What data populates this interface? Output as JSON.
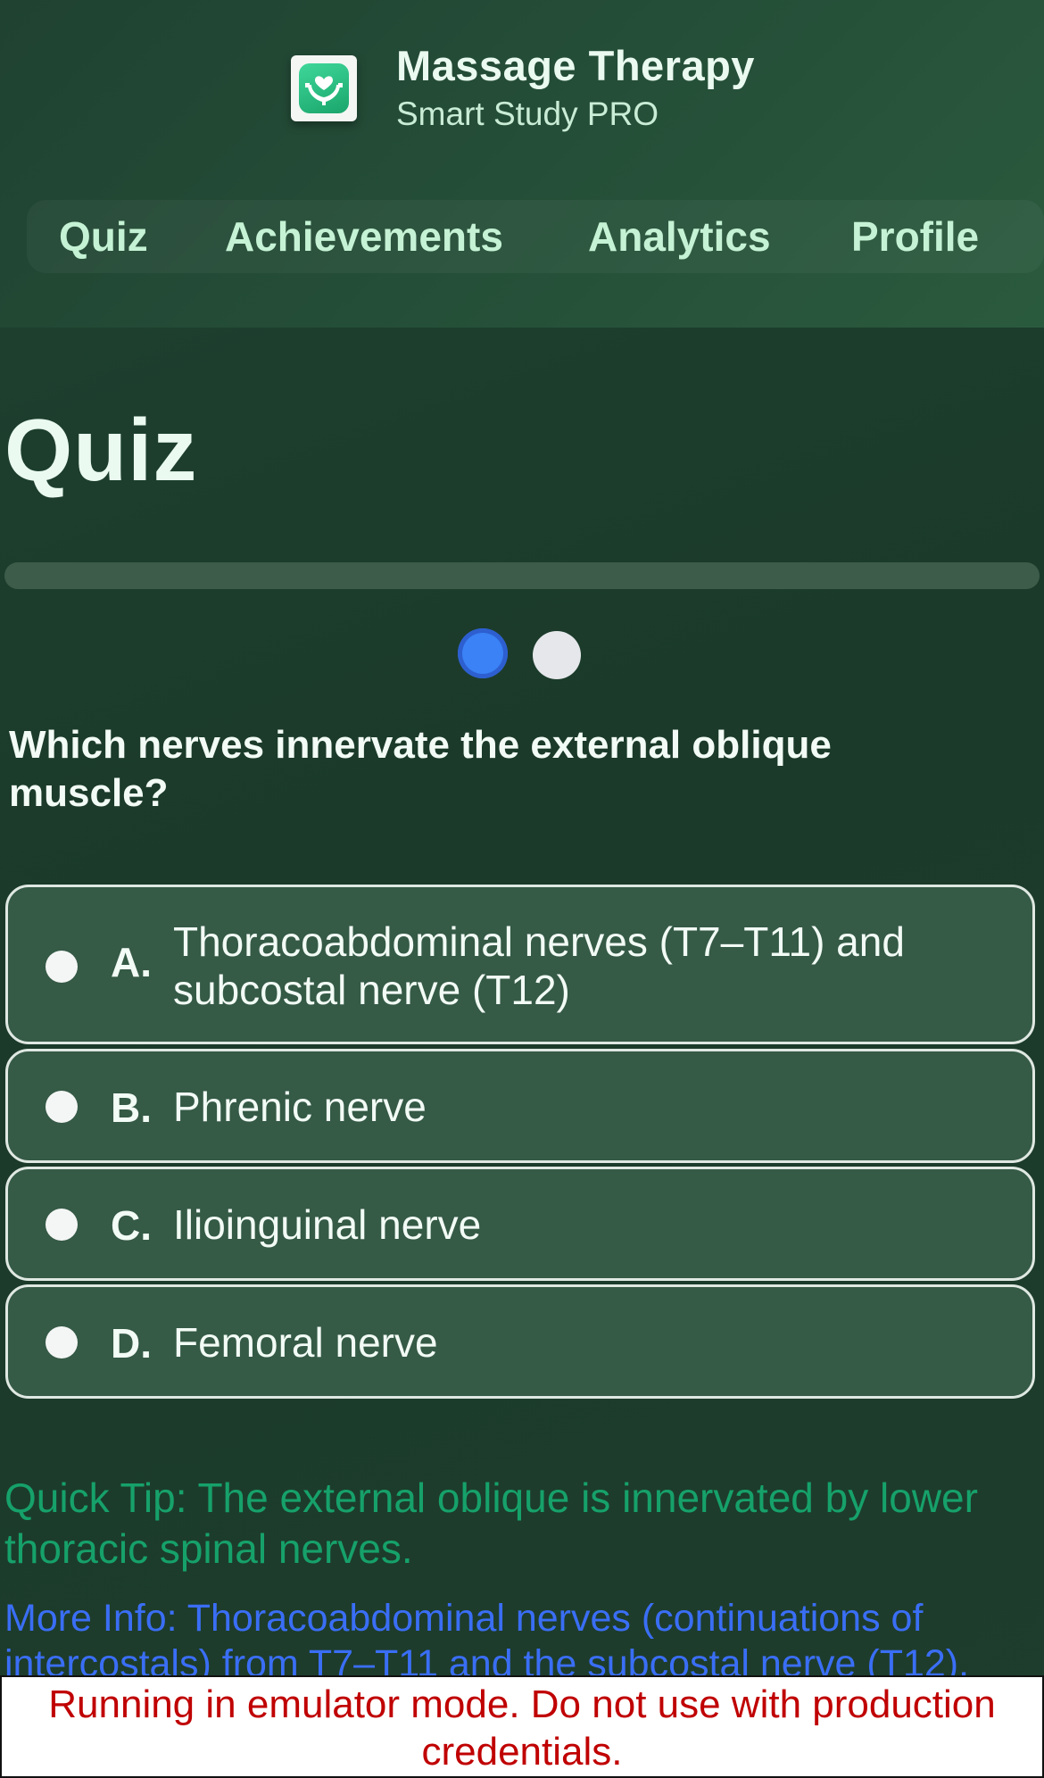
{
  "app": {
    "title": "Massage Therapy",
    "subtitle": "Smart Study PRO",
    "logo_icon": "hands-heart-icon"
  },
  "nav": {
    "items": [
      {
        "label": "Quiz"
      },
      {
        "label": "Achievements"
      },
      {
        "label": "Analytics"
      },
      {
        "label": "Profile"
      }
    ]
  },
  "quiz": {
    "title": "Quiz",
    "progress": 0.0,
    "question_count": 2,
    "current_question": 1,
    "question": "Which nerves innervate the external oblique muscle?",
    "options": [
      {
        "letter": "A.",
        "text": "Thoracoabdominal nerves (T7–T11) and subcostal nerve (T12)"
      },
      {
        "letter": "B.",
        "text": "Phrenic nerve"
      },
      {
        "letter": "C.",
        "text": "Ilioinguinal nerve"
      },
      {
        "letter": "D.",
        "text": "Femoral nerve"
      }
    ],
    "tip": "Quick Tip: The external oblique is innervated by lower thoracic spinal nerves.",
    "more_info": "More Info: Thoracoabdominal nerves (continuations of intercostals) from T7–T11 and the subcostal nerve (T12)."
  },
  "banner": {
    "text": "Running in emulator mode. Do not use with production credentials."
  },
  "colors": {
    "accent": "#3a82f6",
    "nav_text": "#c5f2d4",
    "tip": "#16a16a",
    "more_info": "#3a6ef5",
    "banner_text": "#c00000"
  }
}
